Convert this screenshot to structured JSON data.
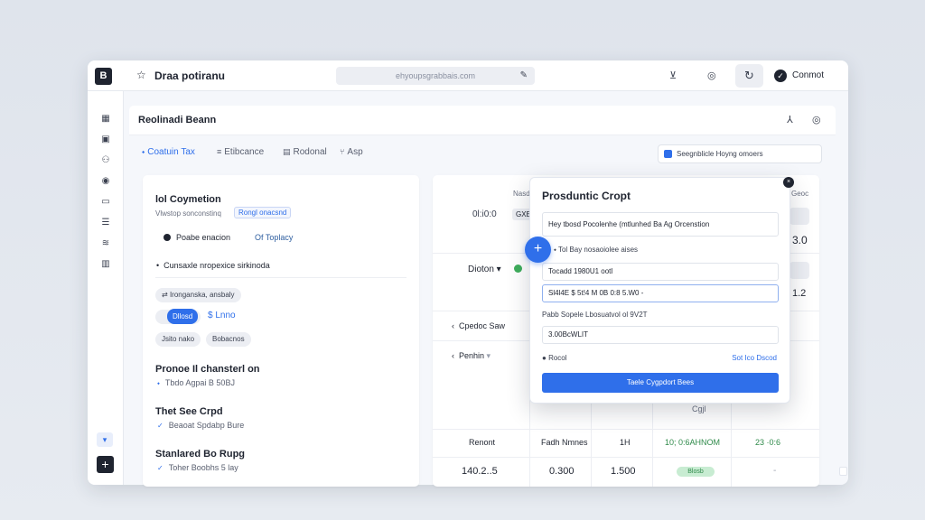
{
  "topbar": {
    "app_title": "Draa potiranu",
    "url": "ehyoupsgrabbais.com",
    "connect_label": "Conmot"
  },
  "header": {
    "title": "Reolinadi Beann"
  },
  "tabs": [
    {
      "label": "Coatuin Tax"
    },
    {
      "label": "Etibcance"
    },
    {
      "label": "Rodonal"
    },
    {
      "label": "Asp"
    }
  ],
  "search": {
    "value": "Seegnblicle Hoyng omoers"
  },
  "left_panel": {
    "title": "lol Coymetion",
    "subtitle": "Vlwstop sonconstinq",
    "subtitle_chip": "Rongl onacsnd",
    "radio1": "Poabe enacion",
    "radio2": "Of Toplacy",
    "bullet": "Cunsaxle nropexice sirkinoda",
    "pill1": "Ironganska, ansbaly",
    "pill_blue": "Dllosd",
    "blue_text": "$ Lnno",
    "pill3": "Jsito nako",
    "pill4": "Bobacnos",
    "sections": [
      {
        "title": "Pronoe Il chansterl on",
        "sub": "Tbdo Agpai B 50BJ"
      },
      {
        "title": "Thet See Crpd",
        "sub": "Beaoat Spdabp Bure"
      },
      {
        "title": "Stanlared Bo Rupg",
        "sub": "Toher Boobhs 5 lay"
      }
    ]
  },
  "right_panel": {
    "col_label_top": "Nasd",
    "col_label_top_right": "Geoc",
    "value_left": "0l:i0:0",
    "value_left_chip": "GXE",
    "value_right_1": "3.0",
    "row2_label": "Dioton",
    "value_right_2": "1.2",
    "list_rows": [
      {
        "label": "Cpedoc Saw"
      },
      {
        "label": "Penhin"
      }
    ],
    "fig": "Cgjl",
    "table_header": [
      "Renont",
      "Fadh Nmnes",
      "1H",
      "10; 0:6AHNOM",
      "23 ·0:6"
    ],
    "table_row": [
      "140.2..5",
      "0.300",
      "1.500",
      "Blosb",
      "-"
    ]
  },
  "popover": {
    "title": "Prosduntic Cropt",
    "field1": "Hey tbosd Pocolenhe (mtlunhed Ba Ag Orcenstion",
    "row_text": "Tol Bay nosaoiolee aises",
    "field2": "Tocadd 1980U1 ootl",
    "field3": "Sl4l4E $ 5t!4 M 0B 0:8 5.W0 -",
    "label_mid": "Pabb Sopele Lbosuatvol ol 9V2T",
    "field4": "3.00BcWLIT",
    "radio_label": "Rocol",
    "link": "Sot Ico Dscod",
    "primary_button": "Taele Cygpdort Bees"
  },
  "colors": {
    "accent": "#2f6fea",
    "dark": "#1f2430",
    "success": "#2f8a4a"
  }
}
